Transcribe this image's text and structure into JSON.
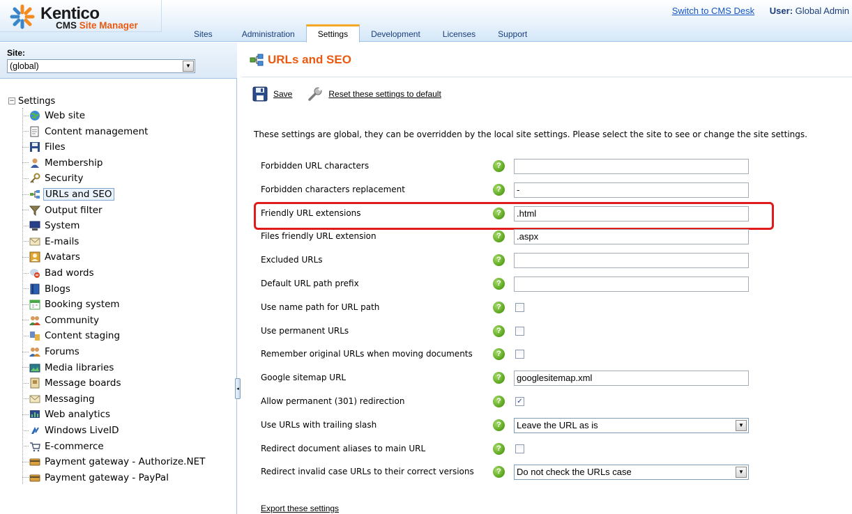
{
  "header": {
    "logo_title": "Kentico",
    "logo_sub_cms": "CMS",
    "logo_sub_rest": "Site Manager",
    "switch_link": "Switch to CMS Desk",
    "user_label": "User:",
    "user_name": "Global Admin",
    "tabs": [
      {
        "label": "Sites",
        "active": false
      },
      {
        "label": "Administration",
        "active": false
      },
      {
        "label": "Settings",
        "active": true
      },
      {
        "label": "Development",
        "active": false
      },
      {
        "label": "Licenses",
        "active": false
      },
      {
        "label": "Support",
        "active": false
      }
    ]
  },
  "sidebar": {
    "site_label": "Site:",
    "site_value": "(global)",
    "root_label": "Settings",
    "root_toggle": "−",
    "items": [
      {
        "label": "Web site",
        "icon": "globe-icon"
      },
      {
        "label": "Content management",
        "icon": "document-icon"
      },
      {
        "label": "Files",
        "icon": "floppy-icon"
      },
      {
        "label": "Membership",
        "icon": "user-icon"
      },
      {
        "label": "Security",
        "icon": "key-icon"
      },
      {
        "label": "URLs and SEO",
        "icon": "sitemap-icon",
        "selected": true
      },
      {
        "label": "Output filter",
        "icon": "funnel-icon"
      },
      {
        "label": "System",
        "icon": "computer-icon"
      },
      {
        "label": "E-mails",
        "icon": "envelope-icon"
      },
      {
        "label": "Avatars",
        "icon": "avatar-icon"
      },
      {
        "label": "Bad words",
        "icon": "bad-words-icon"
      },
      {
        "label": "Blogs",
        "icon": "blog-icon"
      },
      {
        "label": "Booking system",
        "icon": "calendar-icon"
      },
      {
        "label": "Community",
        "icon": "community-icon"
      },
      {
        "label": "Content staging",
        "icon": "staging-icon"
      },
      {
        "label": "Forums",
        "icon": "forums-icon"
      },
      {
        "label": "Media libraries",
        "icon": "media-icon"
      },
      {
        "label": "Message boards",
        "icon": "message-board-icon"
      },
      {
        "label": "Messaging",
        "icon": "messaging-icon"
      },
      {
        "label": "Web analytics",
        "icon": "analytics-icon"
      },
      {
        "label": "Windows LiveID",
        "icon": "liveid-icon"
      },
      {
        "label": "E-commerce",
        "icon": "cart-icon"
      },
      {
        "label": "Payment gateway - Authorize.NET",
        "icon": "payment-icon"
      },
      {
        "label": "Payment gateway - PayPal",
        "icon": "payment-icon"
      }
    ]
  },
  "main": {
    "title": "URLs and SEO",
    "save_label": "Save",
    "reset_label": "Reset these settings to default",
    "info": "These settings are global, they can be overridden by the local site settings. Please select the site to see or change the site settings.",
    "help_glyph": "?",
    "check_glyph": "✓",
    "dropdown_glyph": "▼",
    "settings": [
      {
        "label": "Forbidden URL characters",
        "type": "text",
        "value": ""
      },
      {
        "label": "Forbidden characters replacement",
        "type": "text",
        "value": "-"
      },
      {
        "label": "Friendly URL extensions",
        "type": "text",
        "value": ".html",
        "highlighted": true
      },
      {
        "label": "Files friendly URL extension",
        "type": "text",
        "value": ".aspx"
      },
      {
        "label": "Excluded URLs",
        "type": "text",
        "value": ""
      },
      {
        "label": "Default URL path prefix",
        "type": "text",
        "value": ""
      },
      {
        "label": "Use name path for URL path",
        "type": "checkbox",
        "checked": false
      },
      {
        "label": "Use permanent URLs",
        "type": "checkbox",
        "checked": false
      },
      {
        "label": "Remember original URLs when moving documents",
        "type": "checkbox",
        "checked": false
      },
      {
        "label": "Google sitemap URL",
        "type": "text",
        "value": "googlesitemap.xml"
      },
      {
        "label": "Allow permanent (301) redirection",
        "type": "checkbox",
        "checked": true
      },
      {
        "label": "Use URLs with trailing slash",
        "type": "select",
        "value": "Leave the URL as is"
      },
      {
        "label": "Redirect document aliases to main URL",
        "type": "checkbox",
        "checked": false
      },
      {
        "label": "Redirect invalid case URLs to their correct versions",
        "type": "select",
        "value": "Do not check the URLs case"
      }
    ],
    "export_label": "Export these settings"
  },
  "colors": {
    "accent": "#e85a10",
    "link": "#1656c2",
    "highlight": "#e01b1b",
    "header_bg": "#d4e7f8"
  }
}
